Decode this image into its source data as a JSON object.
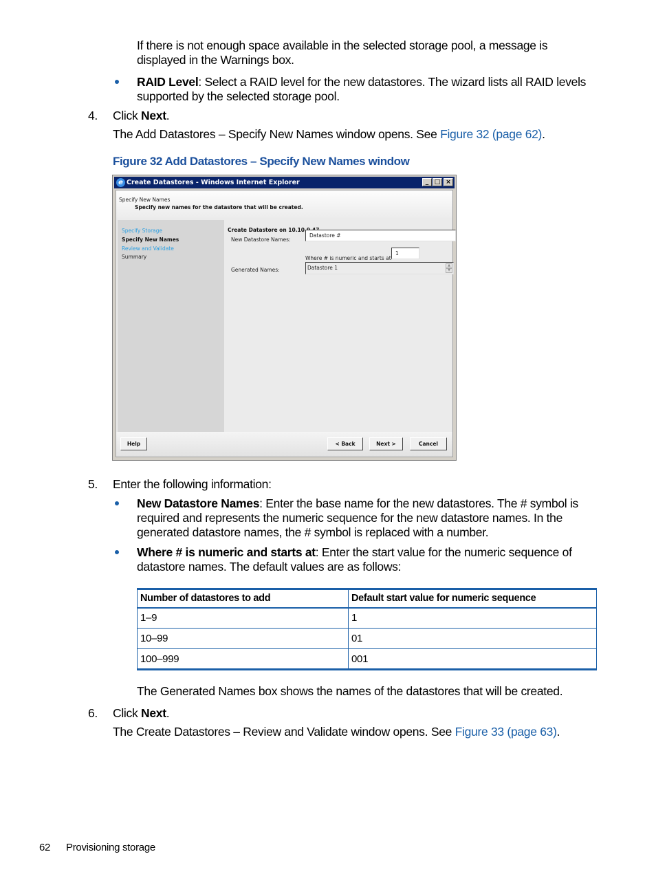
{
  "doc": {
    "para_warnings": "If there is not enough space available in the selected storage pool, a message is displayed in the Warnings box.",
    "raid_bullet": {
      "term": "RAID Level",
      "text": ": Select a RAID level for the new datastores. The wizard lists all RAID levels supported by the selected storage pool."
    },
    "step4": {
      "num": "4.",
      "prefix": "Click ",
      "bold": "Next",
      "suffix": ".",
      "result_text": "The Add Datastores – Specify New Names window opens. See ",
      "result_link": "Figure 32 (page 62)",
      "result_end": "."
    },
    "figure_caption": "Figure 32 Add Datastores – Specify New Names window",
    "step5": {
      "num": "5.",
      "text": "Enter the following information:",
      "bullets": [
        {
          "term": "New Datastore Names",
          "text": ": Enter the base name for the new datastores. The # symbol is required and represents the numeric sequence for the new datastore names. In the generated datastore names, the # symbol is replaced with a number."
        },
        {
          "term": "Where # is numeric and starts at",
          "text": ": Enter the start value for the numeric sequence of datastore names. The default values are as follows:"
        }
      ]
    },
    "table": {
      "headers": [
        "Number of datastores to add",
        "Default start value for numeric sequence"
      ],
      "rows": [
        [
          "1–9",
          "1"
        ],
        [
          "10–99",
          "01"
        ],
        [
          "100–999",
          "001"
        ]
      ]
    },
    "generated_note": "The Generated Names box shows the names of the datastores that will be created.",
    "step6": {
      "num": "6.",
      "prefix": "Click ",
      "bold": "Next",
      "suffix": ".",
      "result_text": "The Create Datastores – Review and Validate window opens. See ",
      "result_link": "Figure 33 (page 63)",
      "result_end": "."
    },
    "page_footer": {
      "page_number": "62",
      "section": "Provisioning storage"
    }
  },
  "window": {
    "title": "Create Datastores - Windows Internet Explorer",
    "header_title": "Specify New Names",
    "header_subtitle": "Specify new names for the datastore that will be created.",
    "steps": [
      {
        "label": "Specify Storage",
        "state": "link"
      },
      {
        "label": "Specify New Names",
        "state": "current"
      },
      {
        "label": "Review and Validate",
        "state": "link"
      },
      {
        "label": "Summary",
        "state": "pending"
      }
    ],
    "main_title": "Create Datastore on 10.10.9.47",
    "new_names_label": "New Datastore Names:",
    "new_names_value": "Datastore #",
    "starts_at_label": "Where # is numeric and starts at",
    "starts_at_value": "1",
    "generated_label": "Generated Names:",
    "generated_value": "Datastore 1",
    "buttons": {
      "help": "Help",
      "back": "< Back",
      "next": "Next >",
      "cancel": "Cancel"
    },
    "titlebar_buttons": {
      "minimize": "_",
      "maximize": "□",
      "close": "×"
    }
  },
  "colors": {
    "link_blue": "#1a5fa8",
    "caption_blue": "#1a4f9c",
    "titlebar": "#0a246a",
    "wizard_link": "#2a9ee0"
  }
}
